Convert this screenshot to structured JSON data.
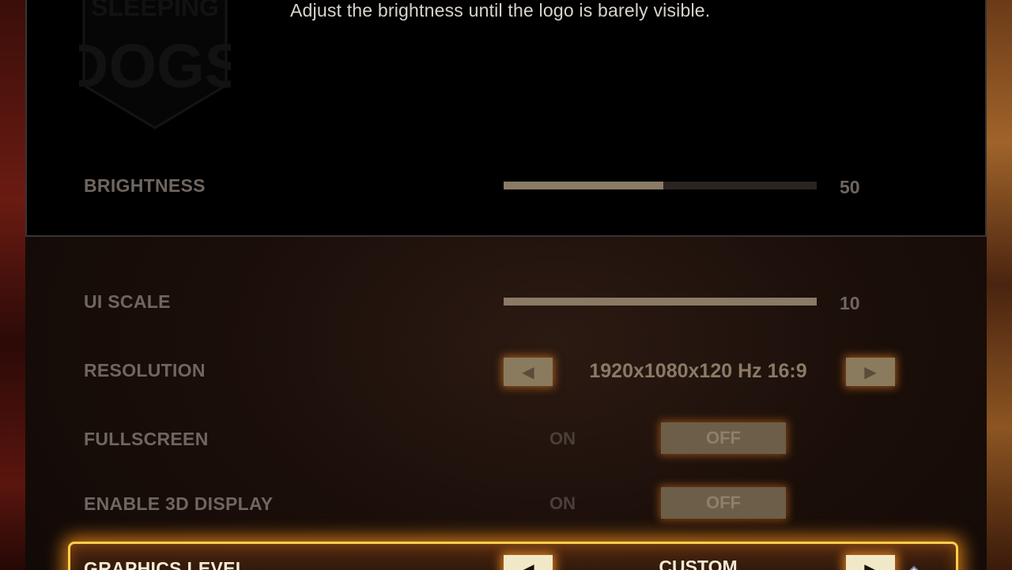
{
  "calibration": {
    "logo_text_line1": "SLEEPING",
    "logo_text_line2": "DOGS",
    "instruction": "Adjust the brightness until the logo is barely visible."
  },
  "settings": {
    "brightness": {
      "label": "BRIGHTNESS",
      "value": "50",
      "fill_fraction": 0.51
    },
    "ui_scale": {
      "label": "UI SCALE",
      "value": "10",
      "fill_fraction": 1.0
    },
    "resolution": {
      "label": "RESOLUTION",
      "value": "1920x1080x120 Hz 16:9",
      "left_arrow": "◀",
      "right_arrow": "▶"
    },
    "fullscreen": {
      "label": "FULLSCREEN",
      "on_label": "ON",
      "off_label": "OFF",
      "selected": "OFF"
    },
    "enable_3d": {
      "label": "ENABLE 3D DISPLAY",
      "on_label": "ON",
      "off_label": "OFF",
      "selected": "OFF"
    },
    "graphics_level": {
      "label": "GRAPHICS LEVEL",
      "value": "CUSTOM",
      "left_arrow": "◀",
      "right_arrow": "▶"
    }
  },
  "colors": {
    "accent_glow": "#ffcf4a",
    "label_dim": "#6f6660",
    "label_bright": "#f3ead6"
  }
}
